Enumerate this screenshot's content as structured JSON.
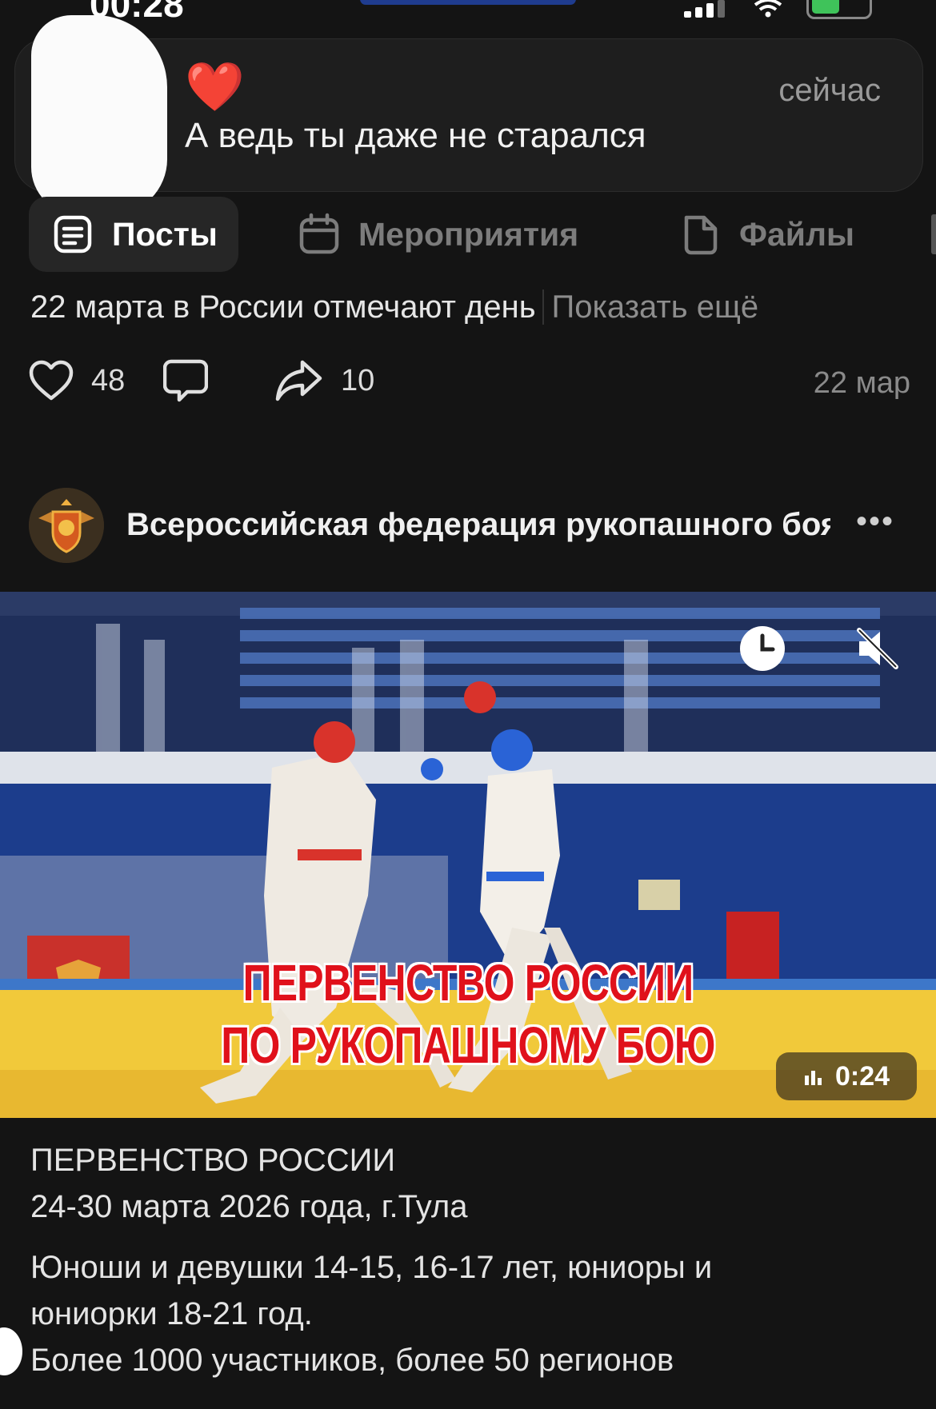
{
  "status_bar": {
    "time": "00:28"
  },
  "notification": {
    "emoji": "❤️",
    "message": "А ведь ты даже не старался",
    "time": "сейчас"
  },
  "tabs": [
    {
      "label": "Посты",
      "icon": "posts-icon",
      "active": true
    },
    {
      "label": "Мероприятия",
      "icon": "calendar-icon",
      "active": false
    },
    {
      "label": "Файлы",
      "icon": "file-icon",
      "active": false
    }
  ],
  "previous_post": {
    "text": "22 марта в России отмечают день",
    "show_more": "Показать ещё",
    "likes": "48",
    "shares": "10",
    "date": "22 мар"
  },
  "post": {
    "author": "Всероссийская федерация рукопашного боя",
    "video": {
      "caption_line1": "ПЕРВЕНСТВО РОССИИ",
      "caption_line2": "ПО РУКОПАШНОМУ БОЮ",
      "duration": "0:24"
    },
    "text_lines": [
      "ПЕРВЕНСТВО РОССИИ",
      "24-30 марта 2026 года, г.Тула",
      "Юноши и девушки 14-15, 16-17 лет, юниоры и",
      "юниорки 18-21 год.",
      "Более 1000 участников, более 50 регионов"
    ]
  },
  "colors": {
    "background": "#141414",
    "heart": "#e8212e",
    "caption_red": "#e0111b",
    "mat_yellow": "#f1c93a",
    "wall_blue": "#1c3d8c"
  }
}
